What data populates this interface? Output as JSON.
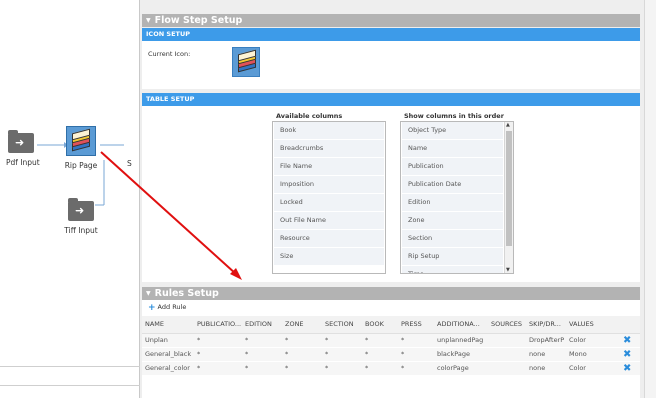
{
  "canvas": {
    "nodes": [
      {
        "label": "Pdf Input",
        "icon": "import-folder-icon"
      },
      {
        "label": "Rip Page",
        "icon": "layers-stack-icon"
      },
      {
        "label": "Tiff Input",
        "icon": "import-folder-icon"
      }
    ],
    "partial_label": "S"
  },
  "flow_step_setup": {
    "title": "Flow Step Setup",
    "icon_setup": {
      "title": "ICON SETUP",
      "current_icon_label": "Current Icon:"
    },
    "table_setup": {
      "title": "TABLE SETUP",
      "available_title": "Available columns",
      "available": [
        "Book",
        "Breadcrumbs",
        "File Name",
        "Imposition",
        "Locked",
        "Out File Name",
        "Resource",
        "Size"
      ],
      "show_title": "Show columns in this order",
      "show": [
        "Object Type",
        "Name",
        "Publication",
        "Publication Date",
        "Edition",
        "Zone",
        "Section",
        "Rip Setup",
        "Time"
      ]
    }
  },
  "rules_setup": {
    "title": "Rules Setup",
    "add_label": "Add Rule",
    "columns": [
      "NAME",
      "PUBLICATIO...",
      "EDITION",
      "ZONE",
      "SECTION",
      "BOOK",
      "PRESS",
      "ADDITIONA...",
      "SOURCES",
      "SKIP/DR...",
      "VALUES",
      ""
    ],
    "rows": [
      [
        "Unplan",
        "*",
        "*",
        "*",
        "*",
        "*",
        "*",
        "unplannedPag",
        "",
        "DropAfterP",
        "Color"
      ],
      [
        "General_black",
        "*",
        "*",
        "*",
        "*",
        "*",
        "*",
        "blackPage",
        "",
        "none",
        "Mono"
      ],
      [
        "General_color",
        "*",
        "*",
        "*",
        "*",
        "*",
        "*",
        "colorPage",
        "",
        "none",
        "Color"
      ]
    ]
  },
  "colors": {
    "section_header": "#b3b3b3",
    "subbar": "#3d9be9",
    "accent": "#2a8cdb",
    "connector": "#e01010"
  }
}
